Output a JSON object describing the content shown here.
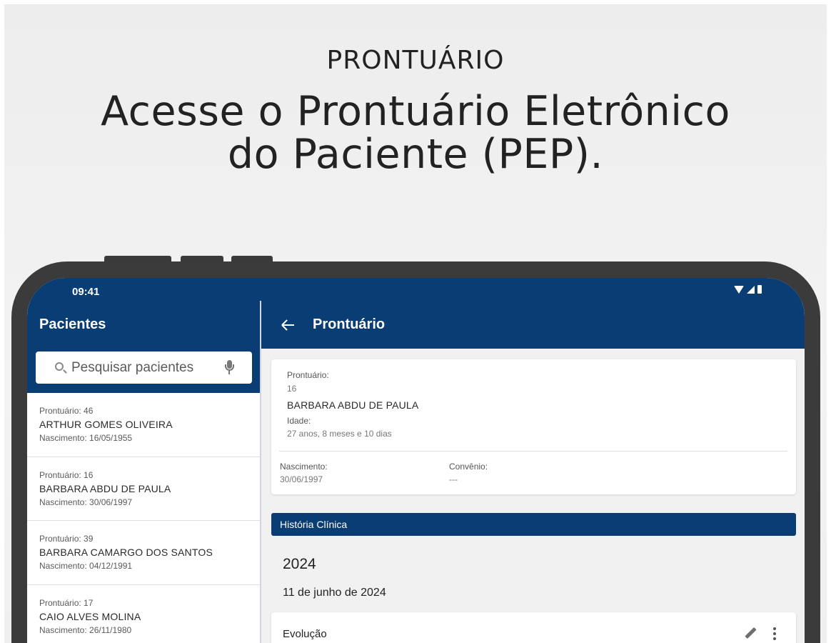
{
  "hero": {
    "kicker": "PRONTUÁRIO",
    "headline_line1": "Acesse o Prontuário Eletrônico",
    "headline_line2": "do Paciente (PEP)."
  },
  "status_bar": {
    "time": "09:41"
  },
  "colors": {
    "primary": "#0a3d73",
    "device_frame": "#3b3b3b"
  },
  "left_pane": {
    "title": "Pacientes",
    "search_placeholder": "Pesquisar pacientes",
    "patients": [
      {
        "prontuario": "Prontuário: 46",
        "name": "ARTHUR GOMES OLIVEIRA",
        "birth": "Nascimento: 16/05/1955"
      },
      {
        "prontuario": "Prontuário: 16",
        "name": "BARBARA ABDU DE PAULA",
        "birth": "Nascimento: 30/06/1997"
      },
      {
        "prontuario": "Prontuário: 39",
        "name": "BARBARA CAMARGO DOS SANTOS",
        "birth": "Nascimento: 04/12/1991"
      },
      {
        "prontuario": "Prontuário: 17",
        "name": "CAIO ALVES MOLINA",
        "birth": "Nascimento: 26/11/1980"
      }
    ]
  },
  "right_pane": {
    "title": "Prontuário",
    "info": {
      "prontuario_label": "Prontuário:",
      "prontuario_value": "16",
      "name": "BARBARA ABDU DE PAULA",
      "idade_label": "Idade:",
      "idade_value": "27 anos, 8 meses e 10 dias",
      "nascimento_label": "Nascimento:",
      "nascimento_value": "30/06/1997",
      "convenio_label": "Convênio:",
      "convenio_value": "---"
    },
    "section_title": "História Clínica",
    "year": "2024",
    "date": "11 de junho de 2024",
    "entry_title": "Evolução"
  }
}
